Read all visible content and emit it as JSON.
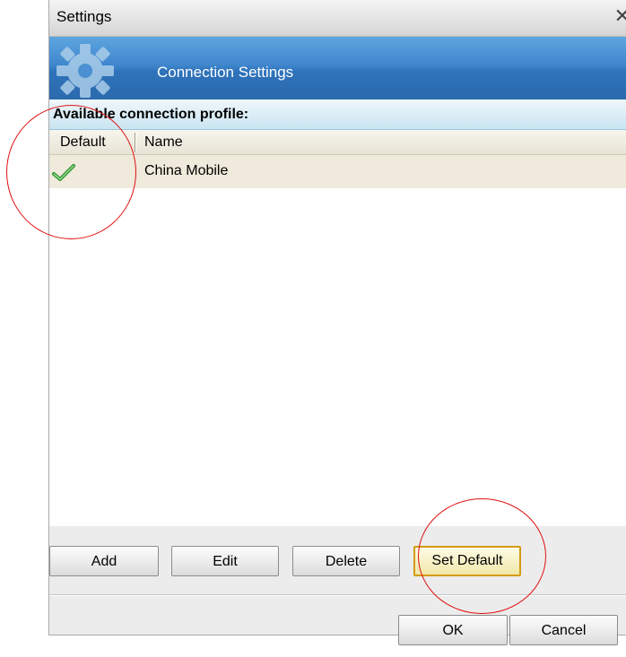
{
  "window": {
    "title": "Settings",
    "close_glyph": "✕"
  },
  "header": {
    "title": "Connection Settings",
    "icon": "gear-icon"
  },
  "profiles": {
    "section_label": "Available connection profile:",
    "columns": [
      "Default",
      "Name"
    ],
    "rows": [
      {
        "is_default": true,
        "name": "China Mobile"
      }
    ]
  },
  "actions": {
    "add": "Add",
    "edit": "Edit",
    "delete": "Delete",
    "set_default": "Set Default"
  },
  "footer": {
    "ok": "OK",
    "cancel": "Cancel"
  },
  "colors": {
    "header_blue": "#3f86cd",
    "check_green": "#3aa83a",
    "annotation_red": "#e01010",
    "focus_border": "#d49a12"
  },
  "icons": {
    "default_marker": "check-icon"
  }
}
